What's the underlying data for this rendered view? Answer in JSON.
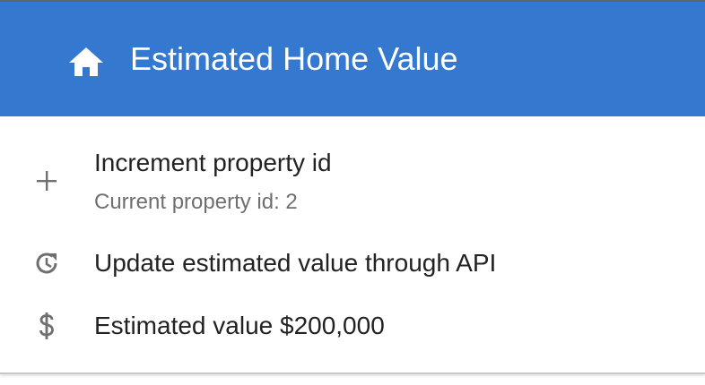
{
  "appbar": {
    "title": "Estimated Home Value",
    "icon": "home-icon",
    "background": "#3578cf"
  },
  "list": {
    "increment": {
      "icon": "plus-icon",
      "label": "Increment property id",
      "secondary": "Current property id: 2"
    },
    "update": {
      "icon": "refresh-clock-icon",
      "label": "Update estimated value through API"
    },
    "value": {
      "icon": "dollar-icon",
      "label": "Estimated value $200,000"
    }
  }
}
